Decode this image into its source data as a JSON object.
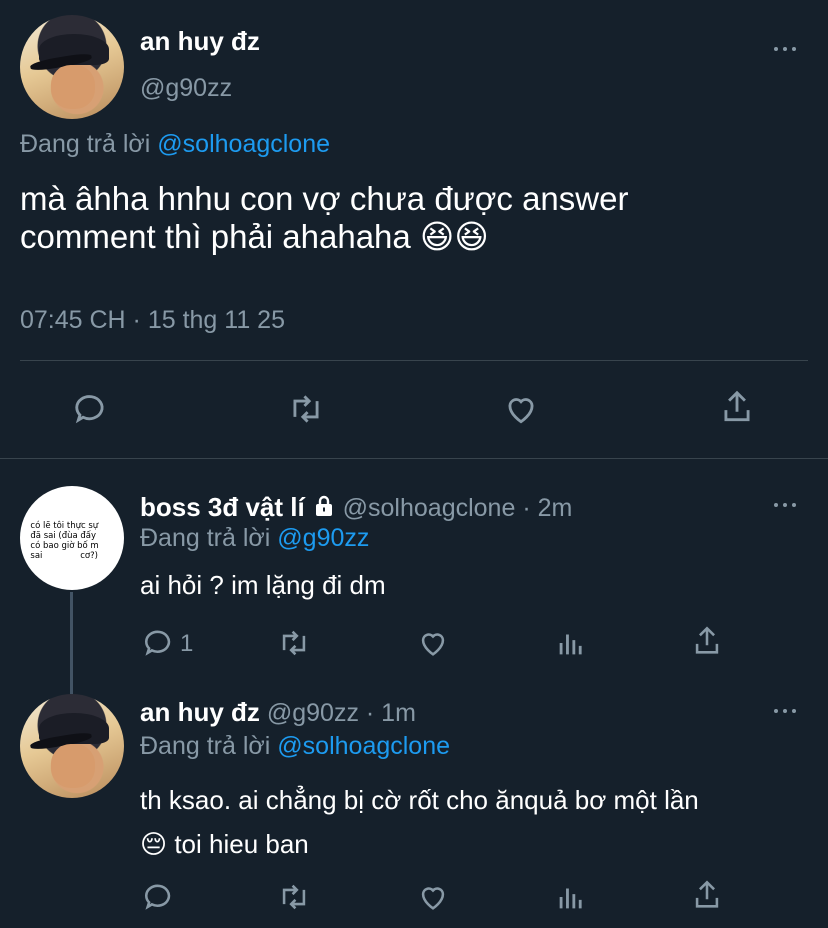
{
  "main_tweet": {
    "display_name": "an huy đz",
    "handle": "@g90zz",
    "replying_prefix": "Đang trả lời",
    "replying_to": "@solhoagclone",
    "text_line1": "mà âhha hnhu con vợ chưa được answer",
    "text_line2": "comment thì phải ahahaha 😆😆",
    "timestamp": "07:45 CH · 15 thg 11 25"
  },
  "reply1": {
    "display_name": "boss 3đ vật lí",
    "handle": "@solhoagclone",
    "time": "· 2m",
    "replying_prefix": "Đang trả lời",
    "replying_to": "@g90zz",
    "text": "ai hỏi ? im lặng đi dm",
    "reply_count": "1",
    "avatar_text": "có lẽ tôi thực sự\nđã sai (đùa đấy\ncó bao giờ bố m\nsai              cơ?)"
  },
  "reply2": {
    "display_name": "an huy đz",
    "handle": "@g90zz",
    "time": "· 1m",
    "replying_prefix": "Đang trả lời",
    "replying_to": "@solhoagclone",
    "text_line1": "th ksao. ai chẳng bị cờ rốt cho ănquả  bơ một lần",
    "text_line2": "😔  toi hieu ban"
  },
  "colors": {
    "background": "#15202b",
    "link": "#1d9bf0",
    "muted": "#8899a6",
    "divider": "#38444d"
  },
  "icons": [
    "more-icon",
    "reply-icon",
    "retweet-icon",
    "like-icon",
    "share-icon",
    "analytics-icon",
    "lock-icon"
  ]
}
